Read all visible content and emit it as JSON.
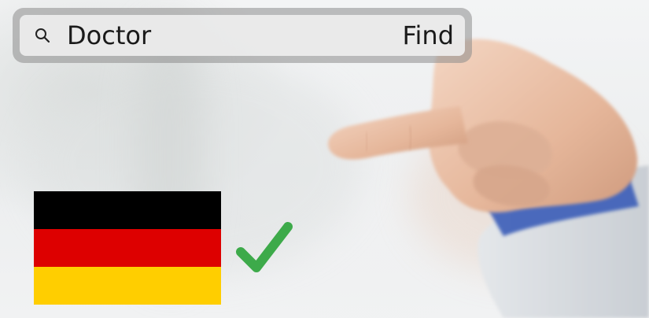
{
  "search": {
    "query": "Doctor",
    "find_label": "Find",
    "icon": "search-icon"
  },
  "flag": {
    "country_icon": "germany-flag-icon",
    "stripes": [
      "#000000",
      "#dd0000",
      "#ffce00"
    ]
  },
  "confirmation": {
    "icon": "check-icon",
    "color": "#3daa4a"
  }
}
